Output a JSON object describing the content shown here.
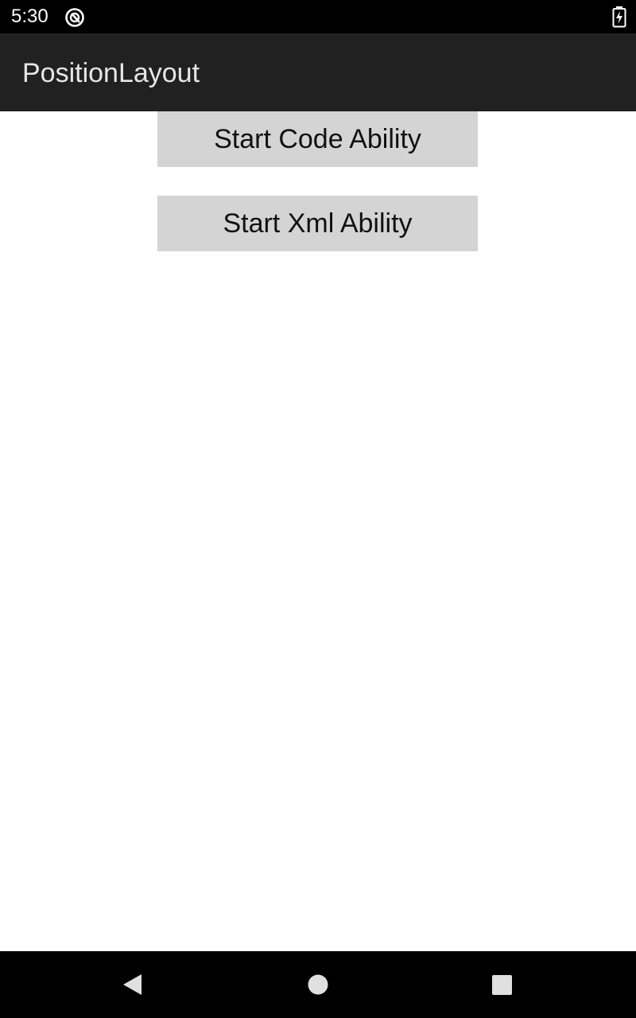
{
  "status_bar": {
    "time": "5:30",
    "icons": [
      "notification-icon",
      "battery-charging-icon"
    ]
  },
  "app_bar": {
    "title": "PositionLayout"
  },
  "main": {
    "buttons": [
      {
        "label": "Start Code Ability"
      },
      {
        "label": "Start Xml Ability"
      }
    ]
  },
  "nav_bar": {
    "icons": [
      "back-icon",
      "home-icon",
      "recents-icon"
    ]
  },
  "colors": {
    "status_bar_bg": "#000000",
    "app_bar_bg": "#212121",
    "button_bg": "#d4d4d4",
    "nav_bar_bg": "#000000"
  }
}
